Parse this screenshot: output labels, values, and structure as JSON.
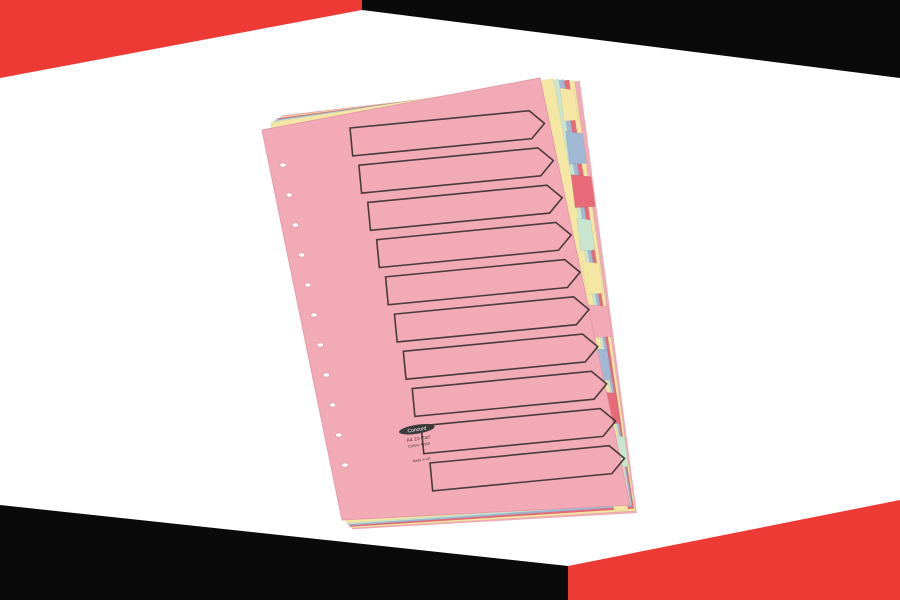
{
  "banner": {
    "accent_color": "#ee3a35",
    "dark_color": "#0a0a0a",
    "background_color": "#ffffff"
  },
  "product": {
    "front_sheet_color": "#f2abb6",
    "label_outline_color": "#4a3a3c",
    "hole_color": "#ffffff",
    "tab_count": 10,
    "tab_colors": [
      "#f4e7a4",
      "#9fb8d3",
      "#e86a78",
      "#c9e5cf",
      "#f4e7a4",
      "#f2abb6",
      "#9fb8d3",
      "#e86a78",
      "#c9e5cf",
      "#f4e7a4"
    ],
    "layer_colors": [
      "#f4e7a4",
      "#c9e5cf",
      "#9fb8d3",
      "#e86a78",
      "#f4e7a4",
      "#f2abb6"
    ],
    "brand_logo": "Concord",
    "size_text": "A4 10 Part",
    "code_text": "Colour Mylar",
    "small_print": "Made in UK"
  }
}
